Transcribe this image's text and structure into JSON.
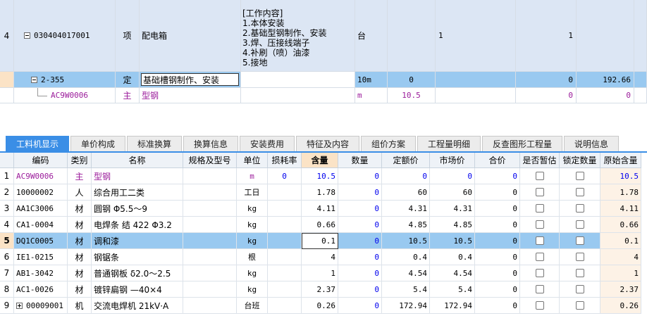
{
  "top_rows": [
    {
      "idx": "4",
      "code": "030404017001",
      "type": "项",
      "name": "配电箱",
      "content": [
        "[工作内容]",
        "1.本体安装",
        "2.基础型钢制作、安装",
        "3.焊、压接线端子",
        "4.补刷（喷）油漆",
        "5.接地"
      ],
      "unit": "台",
      "qty": "",
      "qty2": "1",
      "val1": "1",
      "val2": ""
    },
    {
      "idx": "",
      "code": "2-355",
      "type": "定",
      "name": "基础槽钢制作、安装",
      "content": [],
      "unit": "10m",
      "qty": "0",
      "qty2": "",
      "val1": "0",
      "val2": "192.66"
    },
    {
      "idx": "",
      "code": "AC9W0006",
      "type": "主",
      "name": "型钢",
      "content": [],
      "unit": "m",
      "qty": "10.5",
      "qty2": "",
      "val1": "0",
      "val2": "0"
    }
  ],
  "tabs": [
    "工料机显示",
    "单价构成",
    "标准换算",
    "换算信息",
    "安装费用",
    "特征及内容",
    "组价方案",
    "工程量明细",
    "反查图形工程量",
    "说明信息"
  ],
  "headers": [
    "",
    "编码",
    "类别",
    "名称",
    "规格及型号",
    "单位",
    "损耗率",
    "含量",
    "数量",
    "定额价",
    "市场价",
    "合价",
    "是否暂估",
    "锁定数量",
    "原始含量"
  ],
  "rows": [
    {
      "n": "1",
      "code": "AC9W0006",
      "cat": "主",
      "name": "型钢",
      "unit": "m",
      "loss": "0",
      "content": "10.5",
      "qty": "0",
      "quota": "0",
      "market": "0",
      "total": "0",
      "orig": "10.5",
      "purple": true
    },
    {
      "n": "2",
      "code": "10000002",
      "cat": "人",
      "name": "综合用工二类",
      "unit": "工日",
      "loss": "",
      "content": "1.78",
      "qty": "0",
      "quota": "60",
      "market": "60",
      "total": "0",
      "orig": "1.78"
    },
    {
      "n": "3",
      "code": "AA1C3006",
      "cat": "材",
      "name": "圆钢 Φ5.5～9",
      "unit": "kg",
      "loss": "",
      "content": "4.11",
      "qty": "0",
      "quota": "4.31",
      "market": "4.31",
      "total": "0",
      "orig": "4.11"
    },
    {
      "n": "4",
      "code": "CA1-0004",
      "cat": "材",
      "name": "电焊条 结 422 Φ3.2",
      "unit": "kg",
      "loss": "",
      "content": "0.66",
      "qty": "0",
      "quota": "4.85",
      "market": "4.85",
      "total": "0",
      "orig": "0.66"
    },
    {
      "n": "5",
      "code": "DQ1C0005",
      "cat": "材",
      "name": "调和漆",
      "unit": "kg",
      "loss": "",
      "content": "0.1",
      "qty": "0",
      "quota": "10.5",
      "market": "10.5",
      "total": "0",
      "orig": "0.1",
      "selected": true
    },
    {
      "n": "6",
      "code": "IE1-0215",
      "cat": "材",
      "name": "钢锯条",
      "unit": "根",
      "loss": "",
      "content": "4",
      "qty": "0",
      "quota": "0.4",
      "market": "0.4",
      "total": "0",
      "orig": "4"
    },
    {
      "n": "7",
      "code": "AB1-3042",
      "cat": "材",
      "name": "普通钢板 δ2.0～2.5",
      "unit": "kg",
      "loss": "",
      "content": "1",
      "qty": "0",
      "quota": "4.54",
      "market": "4.54",
      "total": "0",
      "orig": "1"
    },
    {
      "n": "8",
      "code": "AC1-0026",
      "cat": "材",
      "name": "镀锌扁钢 —40×4",
      "unit": "kg",
      "loss": "",
      "content": "2.37",
      "qty": "0",
      "quota": "5.4",
      "market": "5.4",
      "total": "0",
      "orig": "2.37"
    },
    {
      "n": "9",
      "code": "00009001",
      "cat": "机",
      "name": "交流电焊机 21kV·A",
      "unit": "台班",
      "loss": "",
      "content": "0.26",
      "qty": "0",
      "quota": "172.94",
      "market": "172.94",
      "total": "0",
      "orig": "0.26",
      "expand": true
    }
  ]
}
